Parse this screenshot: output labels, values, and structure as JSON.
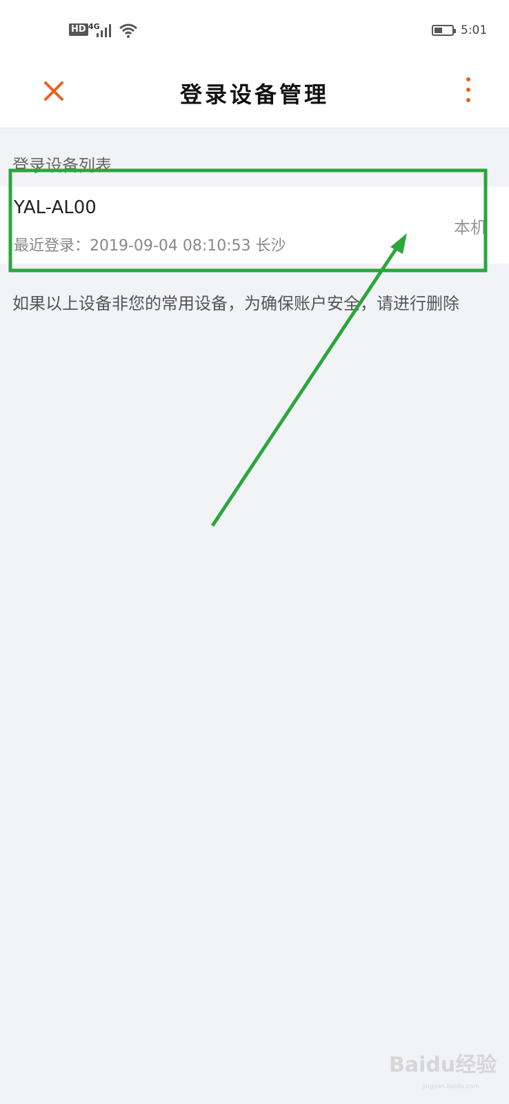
{
  "status_bar": {
    "hd": "HD",
    "network": "4G",
    "time": "5:01",
    "battery_level": 0.45
  },
  "header": {
    "title": "登录设备管理",
    "close_icon": "close-icon",
    "more_icon": "more-vertical-icon",
    "accent_color": "#e8621b"
  },
  "section": {
    "label": "登录设备列表"
  },
  "devices": [
    {
      "name": "YAL-AL00",
      "last_login": "最近登录：2019-09-04 08:10:53 长沙",
      "tag": "本机"
    }
  ],
  "notice": "如果以上设备非您的常用设备，为确保账户安全，请进行删除",
  "annotation": {
    "color": "#2aa63c"
  },
  "watermark": {
    "text": "Baidu经验",
    "sub": "jingyan.baidu.com"
  }
}
